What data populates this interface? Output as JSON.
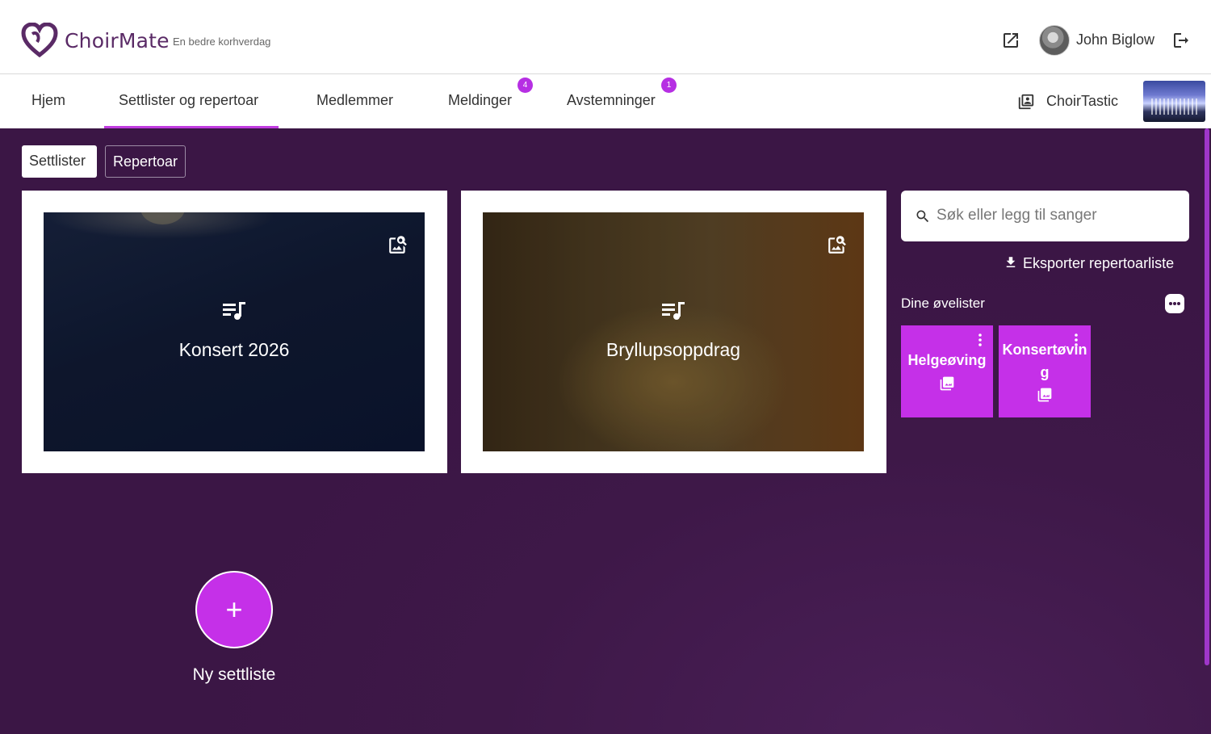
{
  "header": {
    "brand": "ChoirMate",
    "tagline": "En bedre korhverdag",
    "user_name": "John Biglow",
    "icons": [
      "heart-logo-icon",
      "external-link-icon",
      "avatar",
      "logout-icon"
    ]
  },
  "nav": {
    "items": [
      {
        "label": "Hjem"
      },
      {
        "label": "Settlister og repertoar",
        "active": true
      },
      {
        "label": "Medlemmer"
      },
      {
        "label": "Meldinger",
        "badge": "4"
      },
      {
        "label": "Avstemninger",
        "badge": "1"
      }
    ],
    "choir_name": "ChoirTastic",
    "accent_color": "#c03be0"
  },
  "tabs": {
    "settlister": "Settlister",
    "repertoar": "Repertoar"
  },
  "setlists": [
    {
      "title": "Konsert 2026"
    },
    {
      "title": "Bryllupsoppdrag"
    }
  ],
  "search": {
    "placeholder": "Søk eller legg til sanger"
  },
  "export_label": "Eksporter repertoarliste",
  "practice_lists": {
    "heading": "Dine øvelister",
    "items": [
      {
        "title": "Helgeøving"
      },
      {
        "title_line1": "Konsertøvin",
        "title_line2": "g"
      }
    ],
    "color": "#c530e8"
  },
  "new_setlist": {
    "plus": "+",
    "label": "Ny settliste"
  },
  "colors": {
    "background": "#3e1848",
    "accent": "#c530e8",
    "badge": "#b62fe3"
  }
}
